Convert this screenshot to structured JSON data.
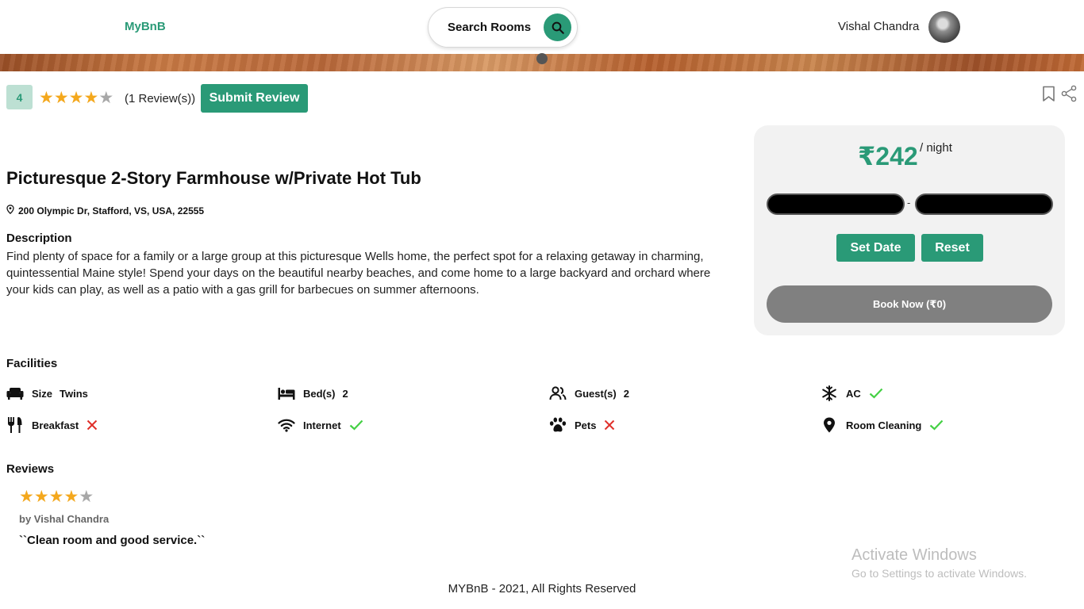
{
  "header": {
    "logo": "MyBnB",
    "search_label": "Search Rooms",
    "user_name": "Vishal Chandra"
  },
  "listing": {
    "rating_badge": "4",
    "rating_stars": 4,
    "rating_max": 5,
    "review_count": "(1 Review(s))",
    "submit_review_label": "Submit Review",
    "title": "Picturesque 2-Story Farmhouse w/Private Hot Tub",
    "address": "200 Olympic Dr, Stafford, VS, USA, 22555",
    "description_heading": "Description",
    "description": "Find plenty of space for a family or a large group at this picturesque Wells home, the perfect spot for a relaxing getaway in charming, quintessential Maine style! Spend your days on the beautiful nearby beaches, and come home to a large backyard and orchard where your kids can play, as well as a patio with a gas grill for barbecues on summer afternoons."
  },
  "booking": {
    "price": "₹242",
    "per_night": "/ night",
    "date_separator": "-",
    "set_date_label": "Set Date",
    "reset_label": "Reset",
    "book_now_label": "Book Now (₹0)"
  },
  "facilities": {
    "heading": "Facilities",
    "items": [
      {
        "icon": "sofa-icon",
        "label": "Size",
        "value": "Twins"
      },
      {
        "icon": "bed-icon",
        "label": "Bed(s)",
        "value": "2"
      },
      {
        "icon": "guests-icon",
        "label": "Guest(s)",
        "value": "2"
      },
      {
        "icon": "snowflake-icon",
        "label": "AC",
        "available": true
      },
      {
        "icon": "utensils-icon",
        "label": "Breakfast",
        "available": false
      },
      {
        "icon": "wifi-icon",
        "label": "Internet",
        "available": true
      },
      {
        "icon": "paw-icon",
        "label": "Pets",
        "available": false
      },
      {
        "icon": "location-pin-icon",
        "label": "Room Cleaning",
        "available": true
      }
    ]
  },
  "reviews": {
    "heading": "Reviews",
    "items": [
      {
        "stars": 4,
        "author": "by Vishal Chandra",
        "text": "``Clean room and good service.``"
      }
    ]
  },
  "watermark": {
    "title": "Activate Windows",
    "subtitle": "Go to Settings to activate Windows."
  },
  "footer": {
    "text": "MYBnB - 2021, All Rights Reserved"
  },
  "colors": {
    "brand": "#2a9a77",
    "star": "#f4a81d",
    "check": "#44d044",
    "cross": "#e0302a"
  }
}
